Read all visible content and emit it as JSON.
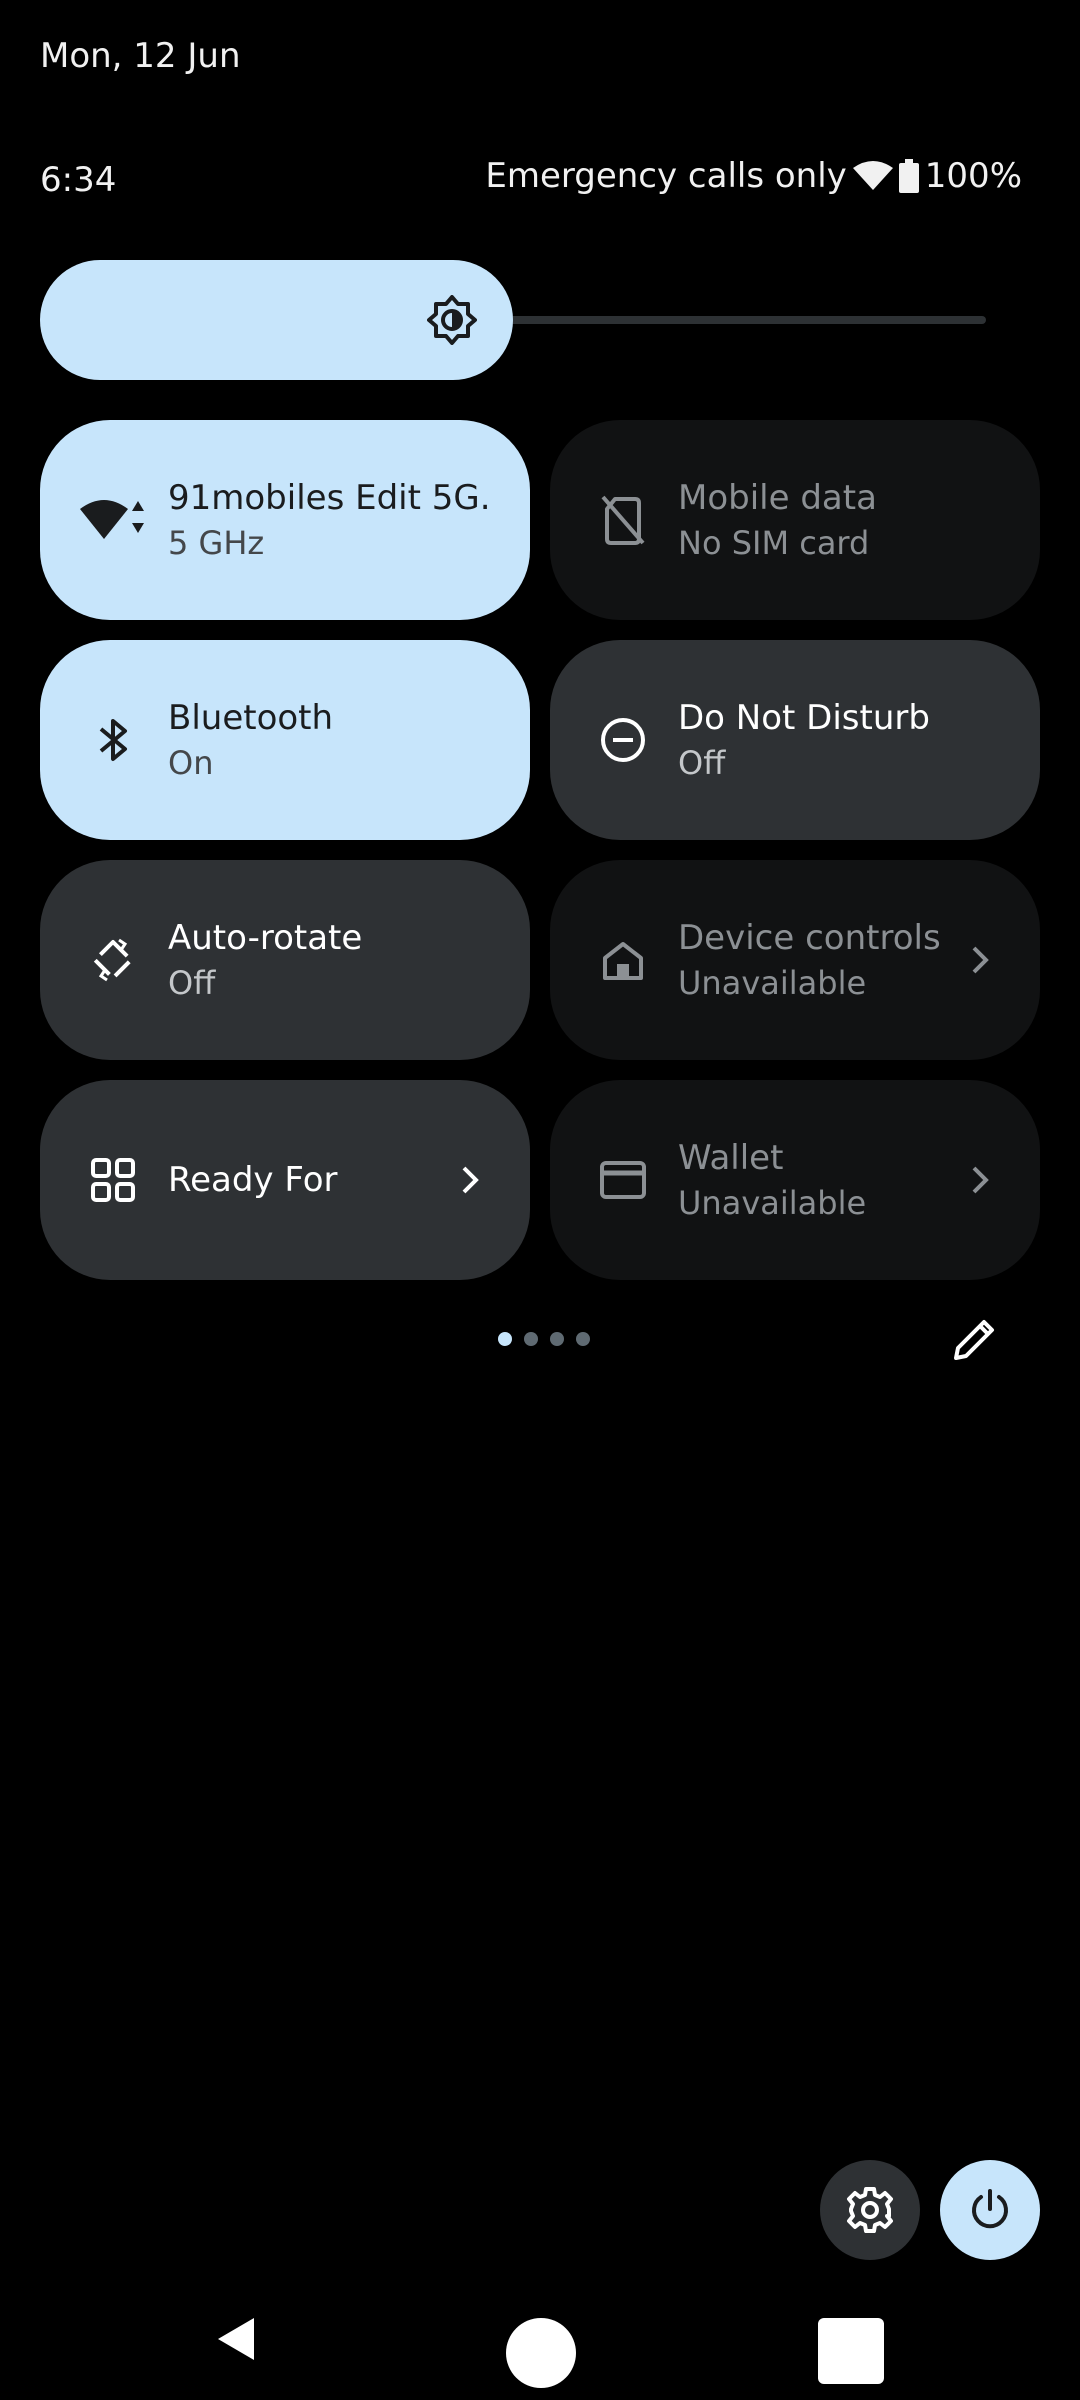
{
  "header": {
    "date": "Mon, 12 Jun",
    "time": "6:34",
    "network_status": "Emergency calls only",
    "battery": "100%"
  },
  "brightness": {
    "level": 0.5
  },
  "tiles": [
    {
      "label": "91mobiles Edit 5G..",
      "sub": "5 GHz",
      "state": "on",
      "icon": "wifi-icon"
    },
    {
      "label": "Mobile data",
      "sub": "No SIM card",
      "state": "dim",
      "icon": "no-sim-icon"
    },
    {
      "label": "Bluetooth",
      "sub": "On",
      "state": "on",
      "icon": "bluetooth-icon"
    },
    {
      "label": "Do Not Disturb",
      "sub": "Off",
      "state": "off",
      "icon": "do-not-disturb-icon"
    },
    {
      "label": "Auto-rotate",
      "sub": "Off",
      "state": "off",
      "icon": "auto-rotate-icon"
    },
    {
      "label": "Device controls",
      "sub": "Unavailable",
      "state": "dim",
      "icon": "home-icon"
    },
    {
      "label": "Ready For",
      "sub": "",
      "state": "off",
      "icon": "grid-icon"
    },
    {
      "label": "Wallet",
      "sub": "Unavailable",
      "state": "dim",
      "icon": "wallet-icon"
    }
  ],
  "pager": {
    "pages": 4,
    "current": 1
  },
  "colors": {
    "accent": "#c7e5fb",
    "tile_off": "#2e3134",
    "tile_dim": "#111213",
    "background": "#000000"
  }
}
